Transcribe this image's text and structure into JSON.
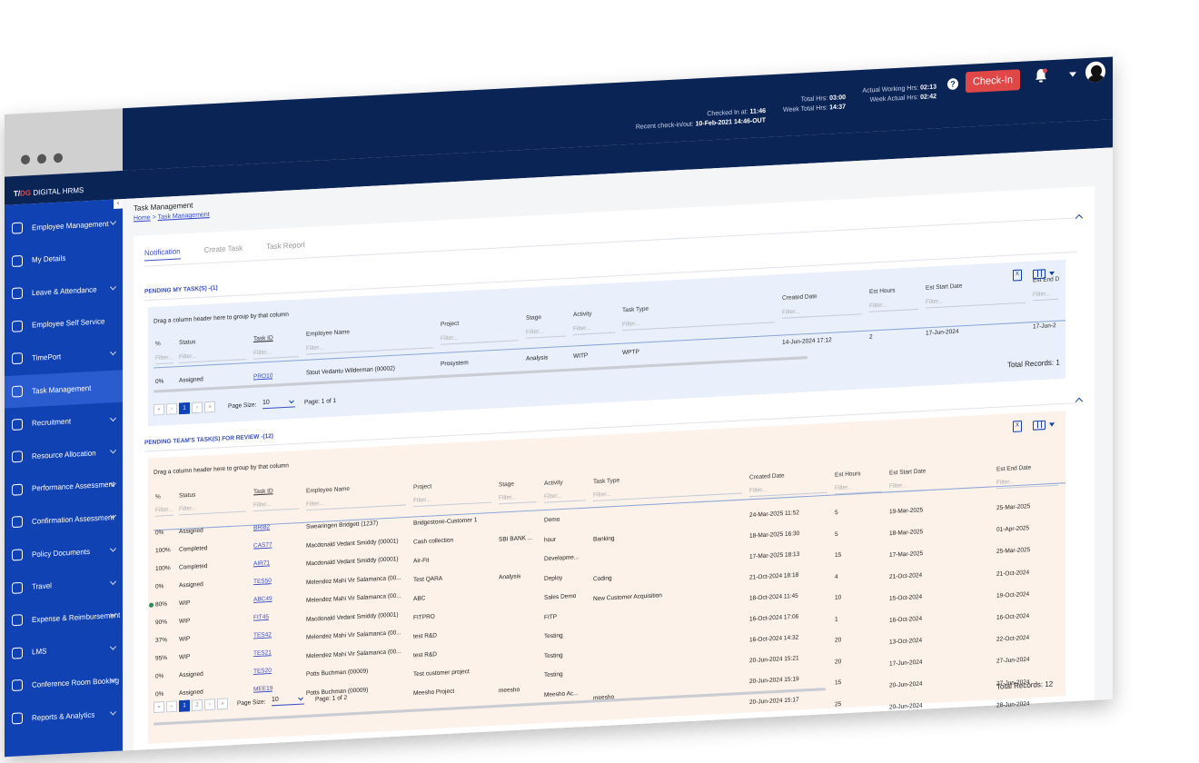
{
  "topbar": {
    "checked_in_label": "Checked In at:",
    "checked_in_value": "11:46",
    "recent_label": "Recent check-in/out:",
    "recent_value": "10-Feb-2021 14:46-OUT",
    "total_hrs_label": "Total Hrs:",
    "total_hrs_value": "03:00",
    "week_total_label": "Week Total Hrs:",
    "week_total_value": "14:37",
    "actual_label": "Actual Working Hrs:",
    "actual_value": "02:13",
    "week_actual_label": "Week Actual Hrs:",
    "week_actual_value": "02:42",
    "help": "?",
    "checkin_label": "Check-In"
  },
  "brand": {
    "logo_pre": "T/",
    "logo_accent": "DG",
    "name": "DIGITAL HRMS"
  },
  "sidebar": {
    "items": [
      {
        "label": "Employee Management",
        "icon": "employee-icon",
        "chevron": true
      },
      {
        "label": "My Details",
        "icon": "person-icon",
        "chevron": false
      },
      {
        "label": "Leave & Attendance",
        "icon": "calendar-icon",
        "chevron": true
      },
      {
        "label": "Employee Self Service",
        "icon": "self-service-icon",
        "chevron": false
      },
      {
        "label": "TimePort",
        "icon": "timesheet-icon",
        "chevron": true
      },
      {
        "label": "Task Management",
        "icon": "task-icon",
        "chevron": false
      },
      {
        "label": "Recruitment",
        "icon": "recruitment-icon",
        "chevron": true
      },
      {
        "label": "Resource Allocation",
        "icon": "resource-icon",
        "chevron": true
      },
      {
        "label": "Performance Assessment",
        "icon": "performance-icon",
        "chevron": true
      },
      {
        "label": "Confirmation Assessment",
        "icon": "confirmation-icon",
        "chevron": true
      },
      {
        "label": "Policy Documents",
        "icon": "document-icon",
        "chevron": true
      },
      {
        "label": "Travel",
        "icon": "plane-icon",
        "chevron": true
      },
      {
        "label": "Expense & Reimbursement",
        "icon": "expense-icon",
        "chevron": true
      },
      {
        "label": "LMS",
        "icon": "lms-icon",
        "chevron": true
      },
      {
        "label": "Conference Room Booking",
        "icon": "conference-icon",
        "chevron": true
      },
      {
        "label": "Reports & Analytics",
        "icon": "reports-icon",
        "chevron": true
      }
    ]
  },
  "page": {
    "title": "Task Management",
    "crumb_home": "Home",
    "crumb_sep": ">",
    "crumb_current": "Task Management"
  },
  "tabs": [
    "Notification",
    "Create Task",
    "Task Report"
  ],
  "section1": {
    "title": "PENDING MY TASK(S) -(1)",
    "drag_text": "Drag a column header here to group by that column",
    "xls": "X",
    "headers": [
      "%",
      "Status",
      "Task ID",
      "Employee Name",
      "Project",
      "Stage",
      "Activity",
      "Task Type",
      "Created Date",
      "Est Hours",
      "Est Start Date",
      "Est End D"
    ],
    "filter_placeholder": "Filter...",
    "rows": [
      [
        "0%",
        "Assigned",
        "PRO10",
        "Stout Vedantu Wilderman (00002)",
        "Prosystem",
        "Analysis",
        "WITP",
        "WPTP",
        "14-Jun-2024 17:12",
        "2",
        "17-Jun-2024",
        "17-Jun-2"
      ]
    ],
    "pager": {
      "first": "«",
      "prev": "‹",
      "pages": [
        "1"
      ],
      "next": "›",
      "last": "»",
      "page_size_label": "Page Size:",
      "page_size": "10",
      "page_info": "Page: 1 of 1"
    },
    "total": "Total Records: 1"
  },
  "section2": {
    "title": "PENDING TEAM'S TASK(S) FOR REVIEW -(12)",
    "drag_text": "Drag a column header here to group by that column",
    "xls": "X",
    "headers": [
      "%",
      "Status",
      "Task ID",
      "Employee Name",
      "Project",
      "Stage",
      "Activity",
      "Task Type",
      "Created Date",
      "Est Hours",
      "Est Start Date",
      "Est End Date"
    ],
    "filter_placeholder": "Filter...",
    "rows": [
      [
        "0%",
        "Assigned",
        "BRI82",
        "Swearingen Bridgett (1237)",
        "Bridgestone-Customer 1",
        "",
        "Demo",
        "",
        "24-Mar-2025 11:52",
        "5",
        "19-Mar-2025",
        "25-Mar-2025"
      ],
      [
        "100%",
        "Completed",
        "CAS77",
        "Macdonald Vedant Smiddy (00001)",
        "Cash collection",
        "SBI BANK ...",
        "hour",
        "Banking",
        "18-Mar-2025 16:30",
        "5",
        "18-Mar-2025",
        "01-Apr-2025"
      ],
      [
        "100%",
        "Completed",
        "AIR71",
        "Macdonald Vedant Smiddy (00001)",
        "Air-Fit",
        "",
        "Developme...",
        "",
        "17-Mar-2025 18:13",
        "15",
        "17-Mar-2025",
        "25-Mar-2025"
      ],
      [
        "0%",
        "Assigned",
        "TES50",
        "Melendez Mahi Vir Salamanca (00...",
        "Test QARA",
        "Analysis",
        "Deploy",
        "Coding",
        "21-Oct-2024 18:18",
        "4",
        "21-Oct-2024",
        "21-Oct-2024"
      ],
      [
        "80%",
        "WIP",
        "ABC49",
        "Melendez Mahi Vir Salamanca (00...",
        "ABC",
        "",
        "Sales Demo",
        "New Customer Acquisition",
        "18-Oct-2024 11:45",
        "10",
        "15-Oct-2024",
        "19-Oct-2024"
      ],
      [
        "90%",
        "WIP",
        "FIT45",
        "Macdonald Vedant Smiddy (00001)",
        "FITPRO",
        "",
        "FITP",
        "",
        "16-Oct-2024 17:06",
        "1",
        "16-Oct-2024",
        "16-Oct-2024"
      ],
      [
        "37%",
        "WIP",
        "TES42",
        "Melendez Mahi Vir Salamanca (00...",
        "test R&D",
        "",
        "Testing",
        "",
        "16-Oct-2024 14:32",
        "20",
        "13-Oct-2024",
        "22-Oct-2024"
      ],
      [
        "95%",
        "WIP",
        "TES21",
        "Melendez Mahi Vir Salamanca (00...",
        "test R&D",
        "",
        "Testing",
        "",
        "20-Jun-2024 15:21",
        "20",
        "17-Jun-2024",
        "27-Jun-2024"
      ],
      [
        "0%",
        "Assigned",
        "TES20",
        "Potts Buchman (00009)",
        "Test customer project",
        "",
        "Testing",
        "",
        "20-Jun-2024 15:19",
        "15",
        "20-Jun-2024",
        "27-Jun-2024"
      ],
      [
        "0%",
        "Assigned",
        "MEE19",
        "Potts Buchman (00009)",
        "Meesho Project",
        "meesho",
        "Meesho Ac...",
        "meesho",
        "20-Jun-2024 15:17",
        "25",
        "20-Jun-2024",
        "28-Jun-2024"
      ]
    ],
    "pager": {
      "first": "«",
      "prev": "‹",
      "pages": [
        "1",
        "2"
      ],
      "next": "›",
      "last": "»",
      "page_size_label": "Page Size:",
      "page_size": "10",
      "page_info": "Page: 1 of 2"
    },
    "total": "Total Records: 12"
  },
  "colors": {
    "navy": "#0b2456",
    "sidebar": "#1142b4",
    "accent": "#3a4fc4",
    "checkin": "#e04848",
    "grid1_bg": "#e9f0fb",
    "grid2_bg": "#fdf2ea"
  }
}
